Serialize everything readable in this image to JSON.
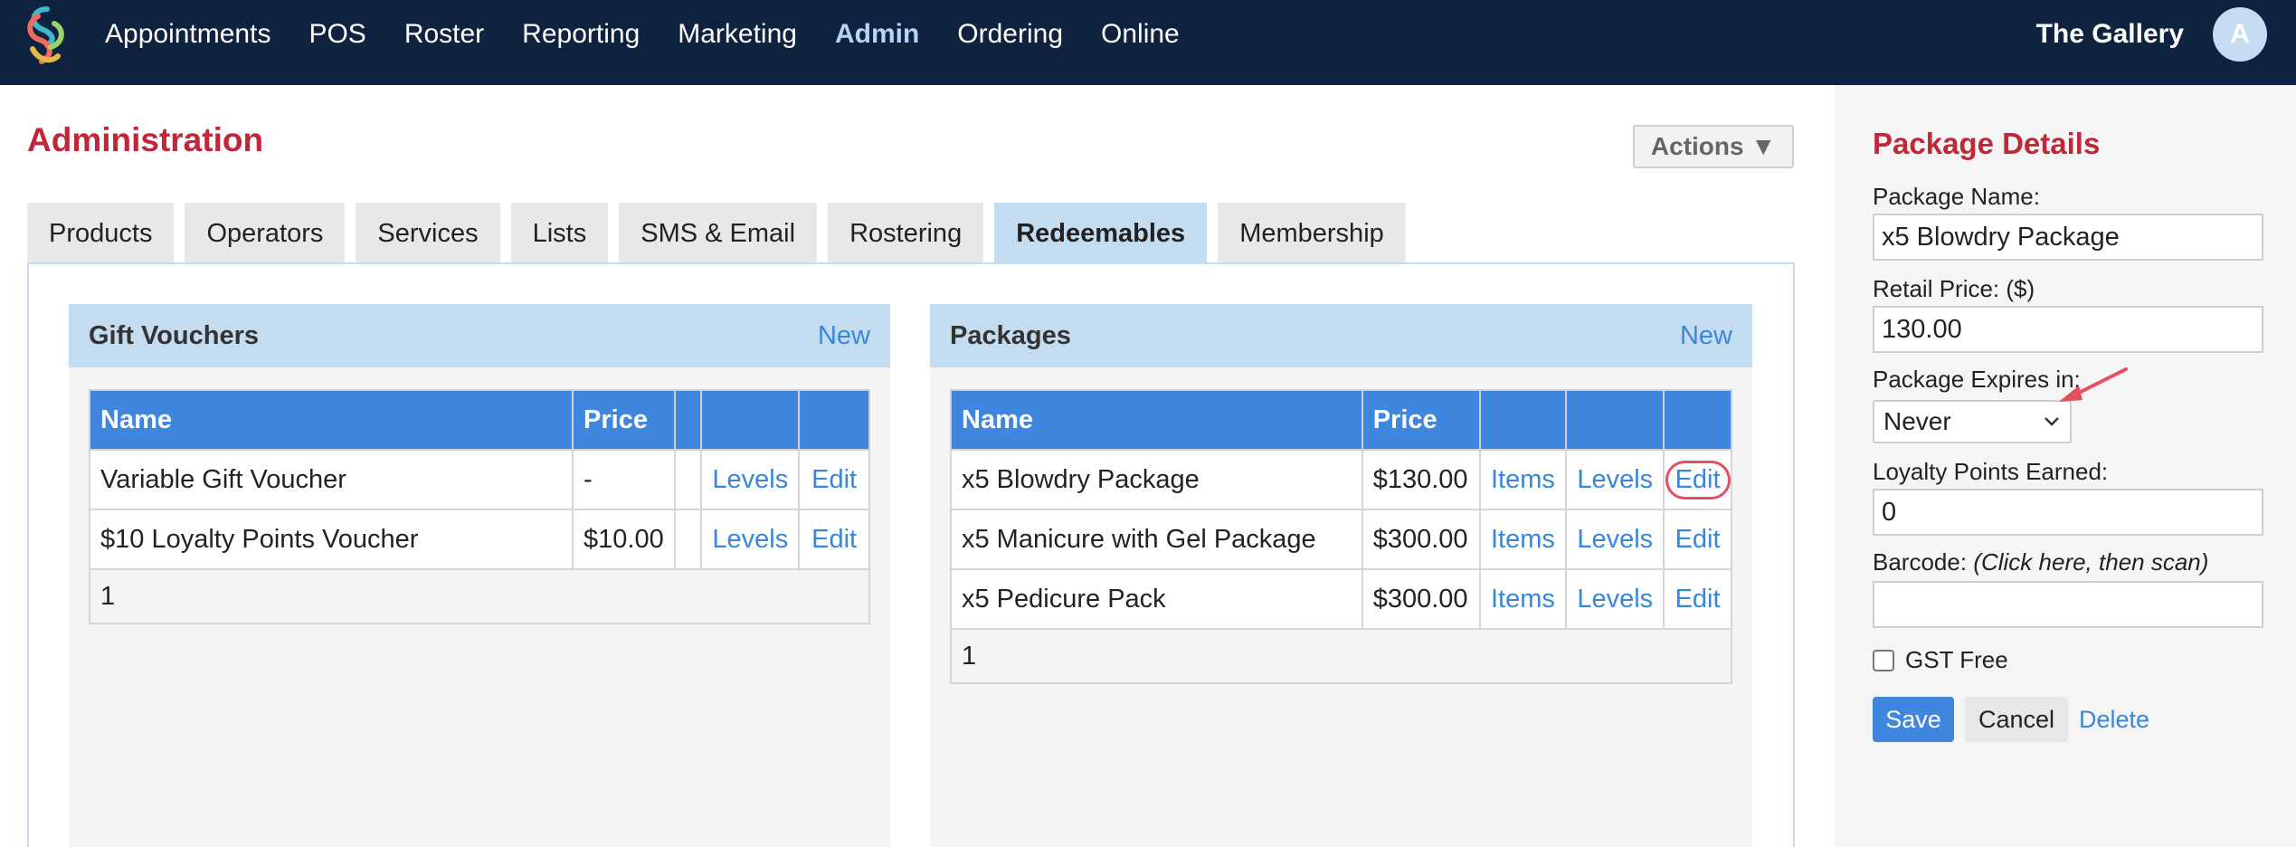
{
  "nav": {
    "items": [
      "Appointments",
      "POS",
      "Roster",
      "Reporting",
      "Marketing",
      "Admin",
      "Ordering",
      "Online"
    ],
    "active": "Admin",
    "shop_name": "The Gallery",
    "avatar_initial": "A"
  },
  "page": {
    "title": "Administration",
    "actions_label": "Actions ▼"
  },
  "tabs": [
    "Products",
    "Operators",
    "Services",
    "Lists",
    "SMS & Email",
    "Rostering",
    "Redeemables",
    "Membership"
  ],
  "active_tab": "Redeemables",
  "gift_vouchers": {
    "title": "Gift Vouchers",
    "new_label": "New",
    "columns": [
      "Name",
      "Price",
      "",
      "",
      ""
    ],
    "rows": [
      {
        "name": "Variable Gift Voucher",
        "price": "-",
        "extra": "",
        "levels": "Levels",
        "edit": "Edit"
      },
      {
        "name": "$10 Loyalty Points Voucher",
        "price": "$10.00",
        "extra": "",
        "levels": "Levels",
        "edit": "Edit"
      }
    ],
    "footer": "1"
  },
  "packages": {
    "title": "Packages",
    "new_label": "New",
    "columns": [
      "Name",
      "Price",
      "",
      "",
      ""
    ],
    "rows": [
      {
        "name": "x5 Blowdry Package",
        "price": "$130.00",
        "items": "Items",
        "levels": "Levels",
        "edit": "Edit"
      },
      {
        "name": "x5 Manicure with Gel Package",
        "price": "$300.00",
        "items": "Items",
        "levels": "Levels",
        "edit": "Edit"
      },
      {
        "name": "x5 Pedicure Pack",
        "price": "$300.00",
        "items": "Items",
        "levels": "Levels",
        "edit": "Edit"
      }
    ],
    "footer": "1"
  },
  "package_details": {
    "title": "Package Details",
    "name_label": "Package Name:",
    "name_value": "x5 Blowdry Package",
    "price_label": "Retail Price: ($)",
    "price_value": "130.00",
    "expires_label": "Package Expires in:",
    "expires_value": "Never",
    "loyalty_label": "Loyalty Points Earned:",
    "loyalty_value": "0",
    "barcode_label": "Barcode:",
    "barcode_hint": "(Click here, then scan)",
    "barcode_value": "",
    "gst_label": "GST Free",
    "save_label": "Save",
    "cancel_label": "Cancel",
    "delete_label": "Delete"
  },
  "colors": {
    "nav_bg": "#0f2340",
    "accent_red": "#c0283a",
    "link_blue": "#3a86d9",
    "table_header": "#3f86de",
    "card_header": "#c3dcf0",
    "highlight": "#e2515f"
  }
}
